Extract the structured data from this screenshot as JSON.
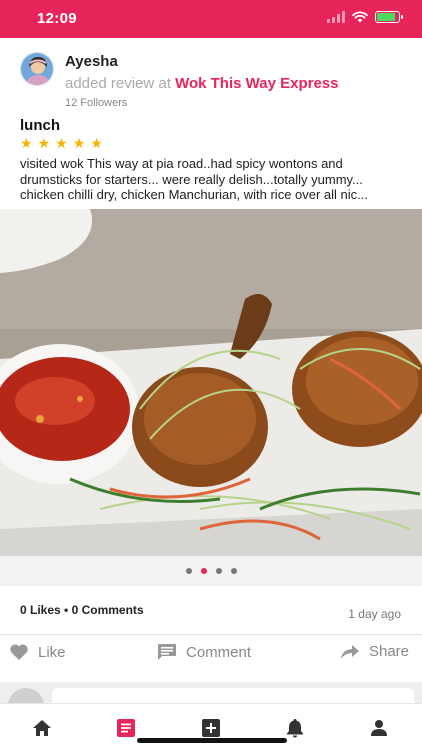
{
  "status_bar": {
    "time": "12:09",
    "battery_level": 0.85,
    "background_color": "#e8255a"
  },
  "post": {
    "author": {
      "name": "Ayesha",
      "followers": "12 Followers",
      "avatar_icon": "user-avatar"
    },
    "action_text": "added review at",
    "restaurant": "Wok This Way Express",
    "review_title": "lunch",
    "rating": 5,
    "review_text": "visited wok This way at pia road..had spicy wontons and drumsticks for starters... were really delish...totally yummy... chicken chilli dry, chicken Manchurian, with rice over all nic...",
    "photo": {
      "icon": "food-photo",
      "page_count": 4,
      "active_page": 2
    },
    "stats": {
      "likes": "0 Likes",
      "separator": " • ",
      "comments": "0 Comments"
    },
    "timestamp": "1 day ago"
  },
  "actions": {
    "like_label": "Like",
    "comment_label": "Comment",
    "share_label": "Share",
    "icons": [
      "heart-icon",
      "comment-icon",
      "share-icon"
    ]
  },
  "tab_bar": {
    "tabs": [
      "home-icon",
      "feed-icon",
      "add-icon",
      "bell-icon",
      "profile-icon"
    ],
    "active_tab": "feed-icon",
    "active_color": "#e8255a",
    "inactive_color": "#333333"
  }
}
